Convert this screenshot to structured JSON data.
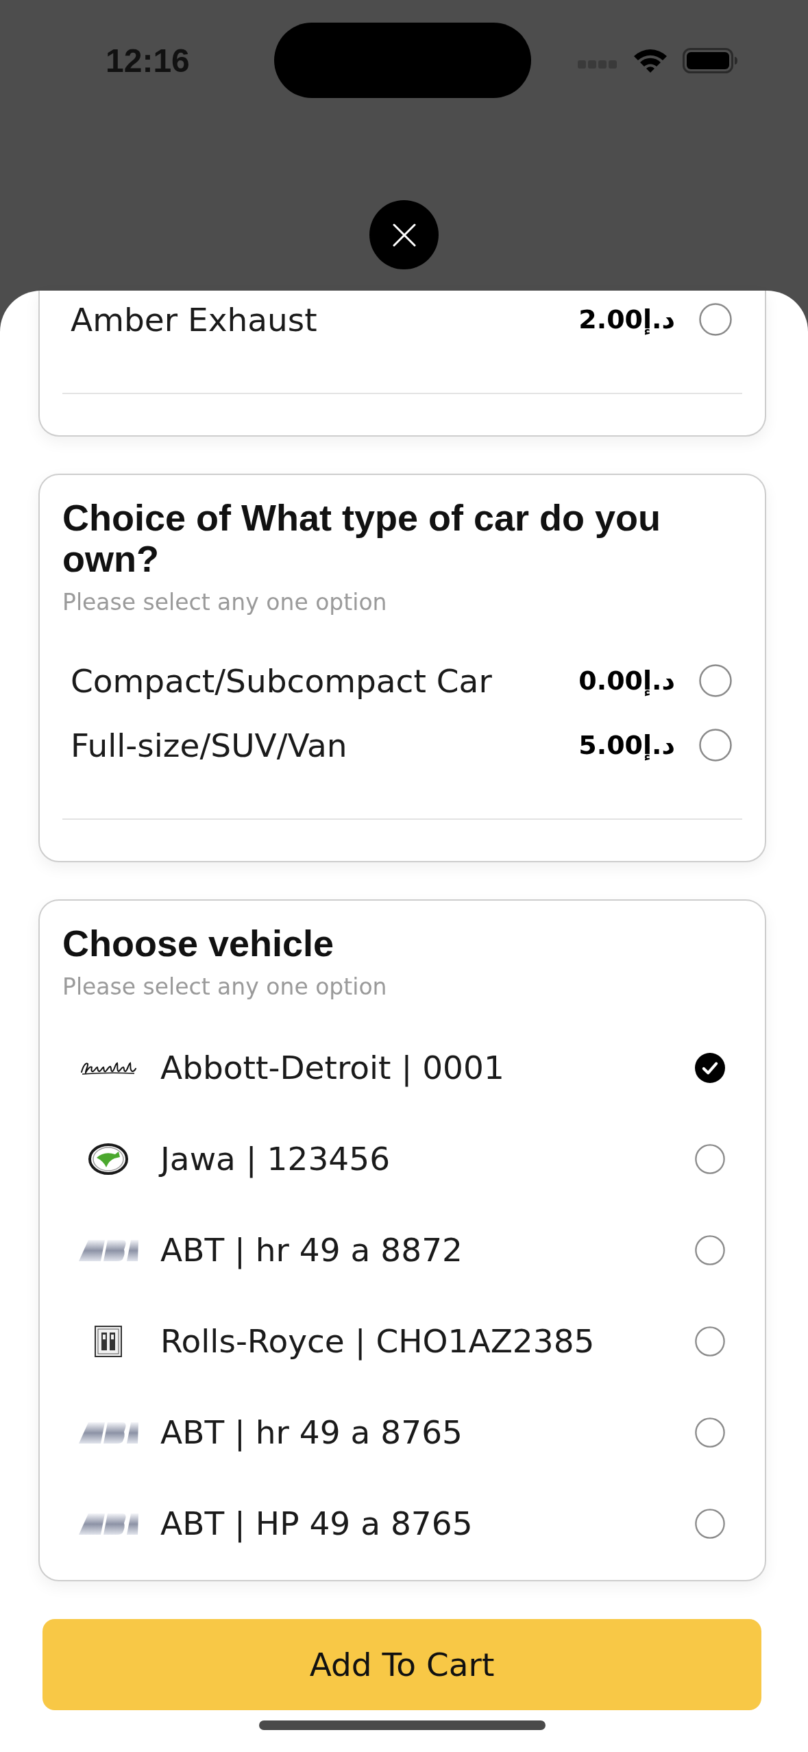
{
  "status_bar": {
    "time": "12:16"
  },
  "option_groups": [
    {
      "options": [
        {
          "label": "Amber Exhaust",
          "price": "2.00د.إ",
          "selected": false
        }
      ]
    },
    {
      "title": "Choice of What type of car do you own?",
      "hint": "Please select any one option",
      "options": [
        {
          "label": "Compact/Subcompact Car",
          "price": "0.00د.إ",
          "selected": false
        },
        {
          "label": "Full-size/SUV/Van",
          "price": "5.00د.إ",
          "selected": false
        }
      ]
    }
  ],
  "vehicle_group": {
    "title": "Choose vehicle",
    "hint": "Please select any one option",
    "vehicles": [
      {
        "label": "Abbott-Detroit | 0001",
        "kind": "script",
        "selected": true
      },
      {
        "label": "Jawa | 123456",
        "kind": "arrow",
        "selected": false
      },
      {
        "label": "ABT | hr 49 a 8872",
        "kind": "chrome",
        "selected": false
      },
      {
        "label": "Rolls-Royce | CHO1AZ2385",
        "kind": "monogram",
        "selected": false
      },
      {
        "label": "ABT | hr 49 a 8765",
        "kind": "chrome",
        "selected": false
      },
      {
        "label": "ABT | HP 49 a 8765",
        "kind": "chrome",
        "selected": false
      }
    ]
  },
  "add_to_cart": {
    "label": "Add To Cart"
  }
}
